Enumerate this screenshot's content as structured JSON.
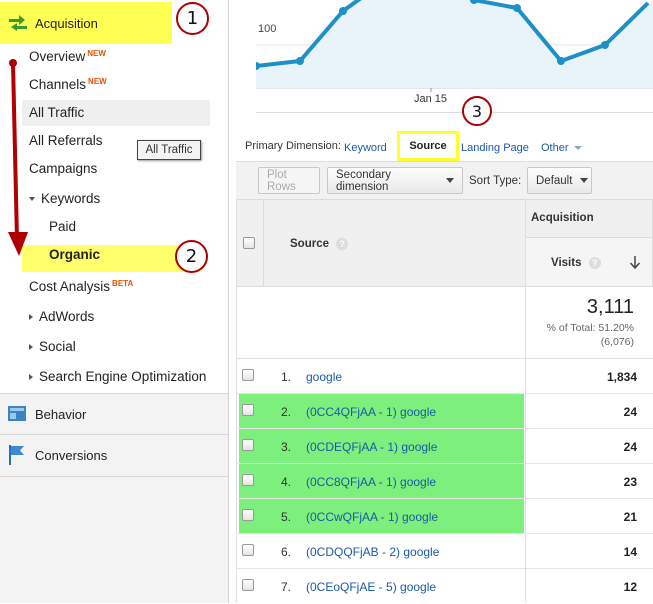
{
  "sidebar": {
    "acquisition": "Acquisition",
    "overview": "Overview",
    "new_badge": "NEW",
    "channels": "Channels",
    "all_traffic": "All Traffic",
    "all_referrals": "All Referrals",
    "campaigns": "Campaigns",
    "keywords": "Keywords",
    "paid": "Paid",
    "organic": "Organic",
    "cost_analysis": "Cost Analysis",
    "beta_badge": "BETA",
    "adwords": "AdWords",
    "social": "Social",
    "seo": "Search Engine Optimization",
    "behavior": "Behavior",
    "conversions": "Conversions",
    "tooltip": "All Traffic"
  },
  "annotations": {
    "one": "1",
    "two": "2",
    "three": "3"
  },
  "chart": {
    "y_tick": "100",
    "x_tick": "Jan 15",
    "line_color": "#1e90c8",
    "fill_color": "#e8f3fa"
  },
  "dimension": {
    "label": "Primary Dimension:",
    "keyword": "Keyword",
    "source": "Source",
    "landing_page": "Landing Page",
    "other": "Other"
  },
  "toolbar": {
    "plot_rows": "Plot Rows",
    "secondary": "Secondary dimension",
    "sort_type_label": "Sort Type:",
    "sort_value": "Default"
  },
  "table": {
    "group_header": "Acquisition",
    "source_header": "Source",
    "visits_header": "Visits",
    "total": "3,111",
    "total_pct": "% of Total: 51.20%",
    "total_base": "(6,076)",
    "rows": [
      {
        "num": "1.",
        "source": "google",
        "visits": "1,834"
      },
      {
        "num": "2.",
        "source": "(0CC4QFjAA - 1) google",
        "visits": "24"
      },
      {
        "num": "3.",
        "source": "(0CDEQFjAA - 1) google",
        "visits": "24"
      },
      {
        "num": "4.",
        "source": "(0CC8QFjAA - 1) google",
        "visits": "23"
      },
      {
        "num": "5.",
        "source": "(0CCwQFjAA - 1) google",
        "visits": "21"
      },
      {
        "num": "6.",
        "source": "(0CDQQFjAB - 2) google",
        "visits": "14"
      },
      {
        "num": "7.",
        "source": "(0CEoQFjAE - 5) google",
        "visits": "12"
      }
    ]
  }
}
